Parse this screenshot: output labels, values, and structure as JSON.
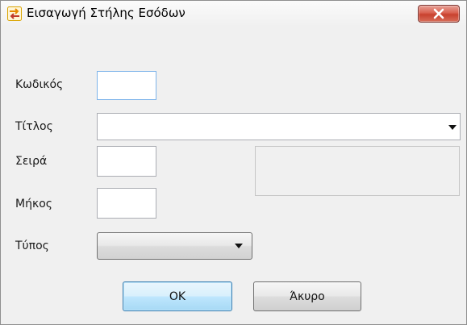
{
  "window": {
    "title": "Εισαγωγή Στήλης Εσόδων",
    "icon": "swap-arrows-icon"
  },
  "form": {
    "code_label": "Κωδικός",
    "code_value": "",
    "title_label": "Τίτλος",
    "title_value": "",
    "order_label": "Σειρά",
    "order_value": "",
    "length_label": "Μήκος",
    "length_value": "",
    "type_label": "Τύπος",
    "type_value": ""
  },
  "buttons": {
    "ok_label": "OK",
    "cancel_label": "Άκυρο"
  },
  "colors": {
    "close_button": "#c8412e",
    "focus_border": "#7eb4ea",
    "default_button": "#3c7fb1"
  }
}
